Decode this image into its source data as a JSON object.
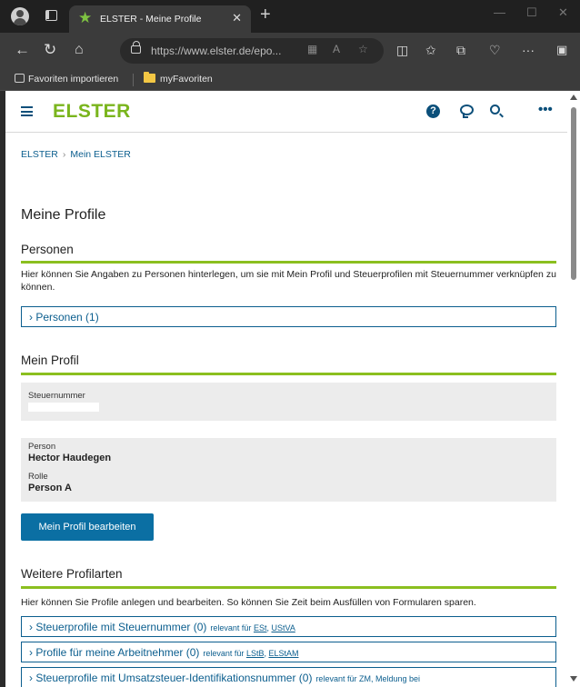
{
  "browser": {
    "tab_title": "ELSTER - Meine Profile",
    "tab_close": "✕",
    "new_tab": "+",
    "url_host": "https://www.elster.de",
    "url_path": "/epo...",
    "bookmarks": [
      {
        "label": "Favoriten importieren"
      },
      {
        "label": "myFavoriten"
      }
    ]
  },
  "header": {
    "logo": "ELSTER",
    "help_icon": "?",
    "more": "•••"
  },
  "breadcrumb": [
    "ELSTER",
    "Mein ELSTER"
  ],
  "page_title": "Meine Profile",
  "personen": {
    "heading": "Personen",
    "text": "Hier können Sie Angaben zu Personen hinterlegen, um sie mit Mein Profil und Steuerprofilen mit Steuernummer verknüpfen zu können.",
    "accordion": "› Personen (1)"
  },
  "mein_profil": {
    "heading": "Mein Profil",
    "steuernummer_label": "Steuernummer",
    "person_label": "Person",
    "person_value": "Hector Haudegen",
    "rolle_label": "Rolle",
    "rolle_value": "Person A",
    "edit_button": "Mein Profil bearbeiten"
  },
  "weitere": {
    "heading": "Weitere Profilarten",
    "text": "Hier können Sie Profile anlegen und bearbeiten. So können Sie Zeit beim Ausfüllen von Formularen sparen.",
    "items": [
      {
        "label": "› Steuerprofile mit Steuernummer (0)",
        "rel_prefix": "relevant für",
        "rel_a": "ESt",
        "rel_sep": ", ",
        "rel_b": "UStVA"
      },
      {
        "label": "› Profile für meine Arbeitnehmer (0)",
        "rel_prefix": "relevant für",
        "rel_a": "LStB",
        "rel_sep": ", ",
        "rel_b": "ELStAM"
      },
      {
        "label": "› Steuerprofile mit Umsatzsteuer-Identifikationsnummer (0)",
        "rel_prefix": "relevant für ZM, Meldung bei",
        "rel_a": "",
        "rel_sep": "",
        "rel_b": ""
      }
    ]
  }
}
